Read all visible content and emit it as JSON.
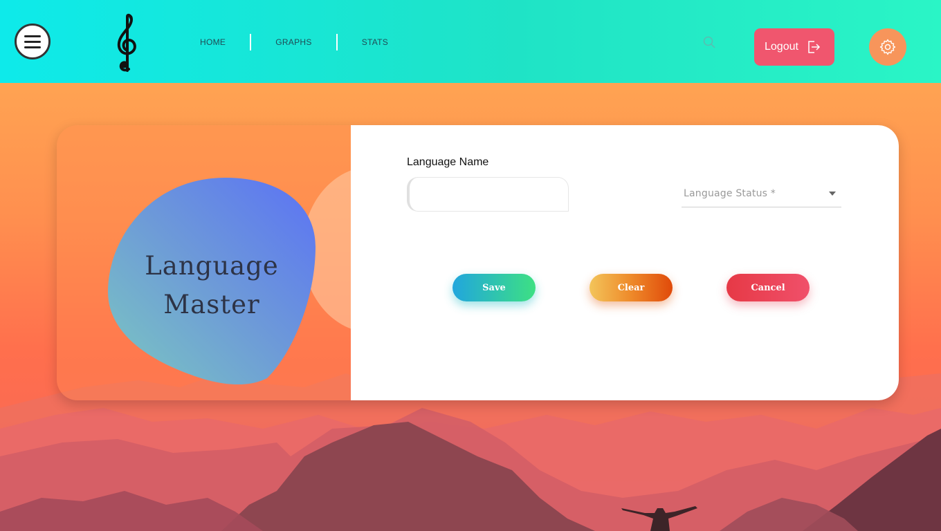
{
  "header": {
    "nav": [
      {
        "label": "HOME"
      },
      {
        "label": "GRAPHS"
      },
      {
        "label": "STATS"
      }
    ],
    "logout_label": "Logout"
  },
  "card": {
    "title_line1": "Language",
    "title_line2": "Master",
    "form": {
      "language_name_label": "Language Name",
      "language_name_value": "",
      "language_status_label": "Language Status *"
    },
    "buttons": {
      "save": "Save",
      "clear": "Clear",
      "cancel": "Cancel"
    }
  },
  "colors": {
    "header_gradient_start": "#0eeaea",
    "header_gradient_end": "#2af5c6",
    "logout_bg": "#f0566e",
    "settings_bg": "#f7955b"
  },
  "icons": [
    "menu-icon",
    "treble-clef-logo-icon",
    "search-icon",
    "logout-icon",
    "gear-icon",
    "chevron-down-icon"
  ]
}
